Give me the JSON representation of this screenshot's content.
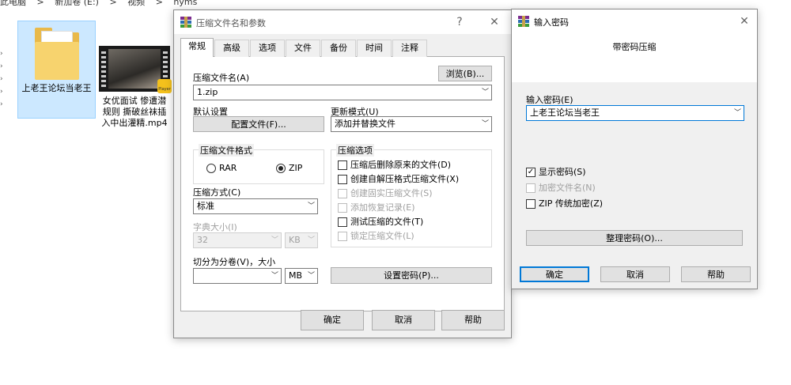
{
  "explorer": {
    "breadcrumb": [
      "此电脑",
      ">",
      "新加卷 (E:)",
      ">",
      "视频",
      ">",
      "nyms"
    ],
    "files": [
      {
        "name": "上老王论坛当老王",
        "type": "folder",
        "selected": true
      },
      {
        "name": "女优面试 惨遭潜规则 撕破丝袜插入中出灌精.mp4",
        "type": "video",
        "badge": "Player"
      }
    ]
  },
  "archive_dialog": {
    "title": "压缩文件名和参数",
    "help_glyph": "?",
    "close_glyph": "✕",
    "tabs": [
      {
        "label": "常规",
        "active": true
      },
      {
        "label": "高级"
      },
      {
        "label": "选项"
      },
      {
        "label": "文件"
      },
      {
        "label": "备份"
      },
      {
        "label": "时间"
      },
      {
        "label": "注释"
      }
    ],
    "archive_name_label": "压缩文件名(A)",
    "browse_button": "浏览(B)...",
    "archive_name_value": "1.zip",
    "default_settings_label": "默认设置",
    "profiles_button": "配置文件(F)...",
    "update_mode_label": "更新模式(U)",
    "update_mode_value": "添加并替换文件",
    "format_group_title": "压缩文件格式",
    "format_rar": "RAR",
    "format_zip": "ZIP",
    "format_selected": "ZIP",
    "options_group_title": "压缩选项",
    "options": [
      {
        "label": "压缩后删除原来的文件(D)",
        "checked": false,
        "enabled": true
      },
      {
        "label": "创建自解压格式压缩文件(X)",
        "checked": false,
        "enabled": true
      },
      {
        "label": "创建固实压缩文件(S)",
        "checked": false,
        "enabled": false
      },
      {
        "label": "添加恢复记录(E)",
        "checked": false,
        "enabled": false
      },
      {
        "label": "测试压缩的文件(T)",
        "checked": false,
        "enabled": true
      },
      {
        "label": "锁定压缩文件(L)",
        "checked": false,
        "enabled": false
      }
    ],
    "method_label": "压缩方式(C)",
    "method_value": "标准",
    "dict_label": "字典大小(I)",
    "dict_value": "32",
    "dict_unit": "KB",
    "split_label": "切分为分卷(V)，大小",
    "split_value": "",
    "split_unit": "MB",
    "set_password_button": "设置密码(P)...",
    "ok_button": "确定",
    "cancel_button": "取消",
    "help_button": "帮助"
  },
  "password_dialog": {
    "title": "输入密码",
    "close_glyph": "✕",
    "header": "带密码压缩",
    "enter_password_label": "输入密码(E)",
    "password_value": "上老王论坛当老王",
    "show_password": {
      "label": "显示密码(S)",
      "checked": true,
      "enabled": true
    },
    "encrypt_filenames": {
      "label": "加密文件名(N)",
      "checked": false,
      "enabled": false
    },
    "zip_legacy": {
      "label": "ZIP 传统加密(Z)",
      "checked": false,
      "enabled": true
    },
    "organize_button": "整理密码(O)...",
    "ok_button": "确定",
    "cancel_button": "取消",
    "help_button": "帮助"
  },
  "colors": {
    "accent": "#0078d7",
    "dialog_bg": "#f0f0f0",
    "selection": "#cce8ff"
  }
}
